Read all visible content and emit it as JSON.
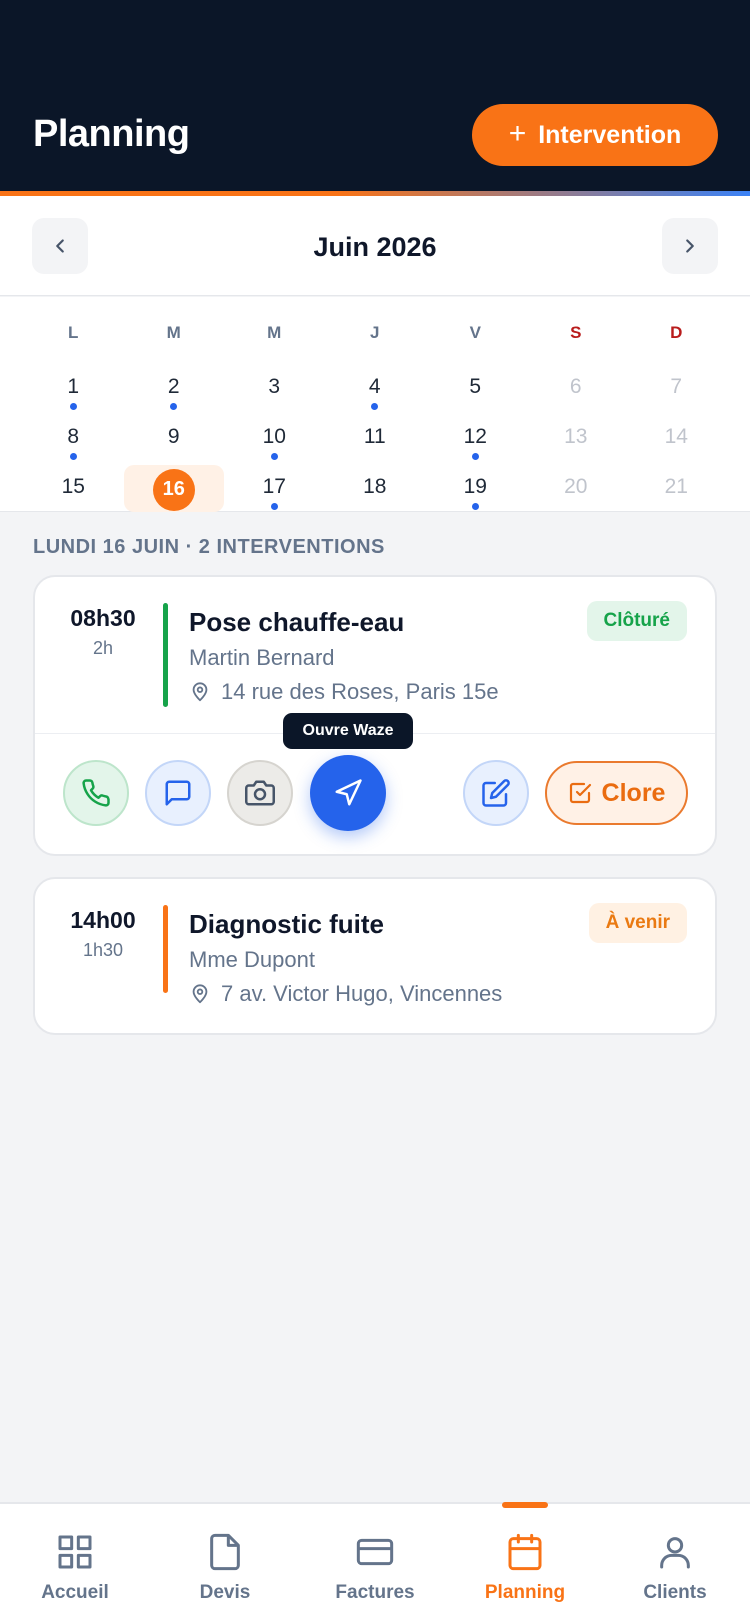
{
  "header": {
    "title": "Planning",
    "add_label": "Intervention"
  },
  "month_nav": {
    "label": "Juin 2026"
  },
  "calendar": {
    "weekdays": [
      "L",
      "M",
      "M",
      "J",
      "V",
      "S",
      "D"
    ],
    "weeks": [
      [
        {
          "n": "1",
          "dot": true
        },
        {
          "n": "2",
          "dot": true
        },
        {
          "n": "3",
          "dot": false
        },
        {
          "n": "4",
          "dot": true
        },
        {
          "n": "5",
          "dot": false
        },
        {
          "n": "6",
          "dot": false
        },
        {
          "n": "7",
          "dot": false
        }
      ],
      [
        {
          "n": "8",
          "dot": true
        },
        {
          "n": "9",
          "dot": false
        },
        {
          "n": "10",
          "dot": true
        },
        {
          "n": "11",
          "dot": false
        },
        {
          "n": "12",
          "dot": true
        },
        {
          "n": "13",
          "dot": false
        },
        {
          "n": "14",
          "dot": false
        }
      ],
      [
        {
          "n": "15",
          "dot": false
        },
        {
          "n": "16",
          "dot": false,
          "selected": true
        },
        {
          "n": "17",
          "dot": true
        },
        {
          "n": "18",
          "dot": false
        },
        {
          "n": "19",
          "dot": true
        },
        {
          "n": "20",
          "dot": false
        },
        {
          "n": "21",
          "dot": false
        }
      ]
    ]
  },
  "day_section": {
    "title": "LUNDI 16 JUIN · 2 INTERVENTIONS"
  },
  "interventions": [
    {
      "time": "08h30",
      "duration": "2h",
      "title": "Pose chauffe-eau",
      "client": "Martin Bernard",
      "address": "14 rue des Roses, Paris 15e",
      "status": "Clôturé",
      "bar_color": "#16a34a",
      "tooltip": "Ouvre Waze",
      "close_label": "Clore"
    },
    {
      "time": "14h00",
      "duration": "1h30",
      "title": "Diagnostic fuite",
      "client": "Mme Dupont",
      "address": "7 av. Victor Hugo, Vincennes",
      "status": "À venir",
      "bar_color": "#f97316"
    }
  ],
  "bottom_nav": {
    "tabs": [
      {
        "label": "Accueil",
        "icon": "grid-icon"
      },
      {
        "label": "Devis",
        "icon": "document-icon"
      },
      {
        "label": "Factures",
        "icon": "card-icon"
      },
      {
        "label": "Planning",
        "icon": "calendar-icon",
        "active": true
      },
      {
        "label": "Clients",
        "icon": "user-icon"
      }
    ]
  },
  "colors": {
    "accent": "#f97316",
    "primary": "#2563eb",
    "header_bg": "#0b1628",
    "success": "#16a34a"
  }
}
